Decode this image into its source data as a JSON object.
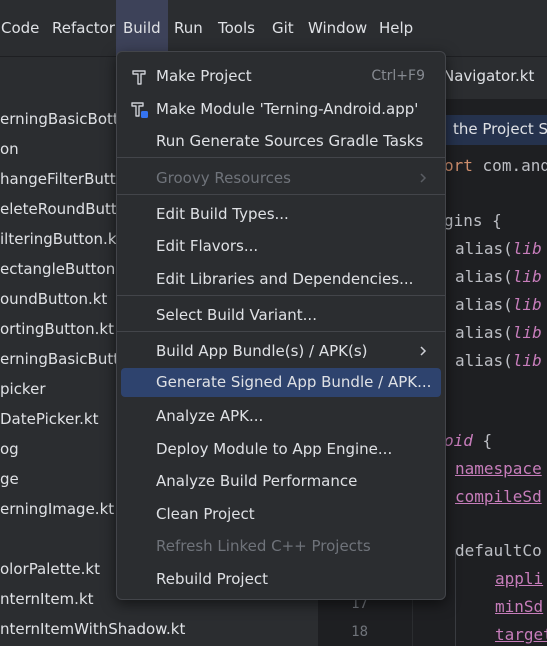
{
  "menubar": {
    "items": [
      {
        "label": "Code"
      },
      {
        "label": "Refactor"
      },
      {
        "label": "Build"
      },
      {
        "label": "Run"
      },
      {
        "label": "Tools"
      },
      {
        "label": "Git"
      },
      {
        "label": "Window"
      },
      {
        "label": "Help"
      }
    ],
    "active": "Build"
  },
  "build_menu": {
    "items": [
      {
        "label": "Make Project",
        "shortcut": "Ctrl+F9",
        "icon": "hammer-icon"
      },
      {
        "label": "Make Module 'Terning-Android.app'",
        "icon": "hammer-module-icon"
      },
      {
        "label": "Run Generate Sources Gradle Tasks"
      },
      {
        "label": "Groovy Resources",
        "disabled": true,
        "submenu": true
      },
      {
        "label": "Edit Build Types..."
      },
      {
        "label": "Edit Flavors..."
      },
      {
        "label": "Edit Libraries and Dependencies..."
      },
      {
        "label": "Select Build Variant..."
      },
      {
        "label": "Build App Bundle(s) / APK(s)",
        "submenu": true
      },
      {
        "label": "Generate Signed App Bundle / APK...",
        "selected": true
      },
      {
        "label": "Analyze APK..."
      },
      {
        "label": "Deploy Module to App Engine..."
      },
      {
        "label": "Analyze Build Performance"
      },
      {
        "label": "Clean Project"
      },
      {
        "label": "Refresh Linked C++ Projects",
        "disabled": true
      },
      {
        "label": "Rebuild Project"
      }
    ]
  },
  "project_tree": {
    "items": [
      "erningBasicBotto",
      "on",
      "hangeFilterButto",
      "eleteRoundButto",
      "ilteringButton.kt",
      "ectangleButton.kt",
      "oundButton.kt",
      "ortingButton.kt",
      "erningBasicButto",
      "picker",
      "DatePicker.kt",
      "og",
      "ge",
      "erningImage.kt",
      "olorPalette.kt",
      "nternItem.kt",
      "nternItemWithShadow.kt"
    ]
  },
  "editor": {
    "tab_label": "Navigator.kt",
    "banner_text": "the Project Str",
    "line_numbers": [
      "17",
      "18"
    ],
    "code": {
      "import_kw": "ort",
      "import_rest": "com.and",
      "plugins": "gins {",
      "alias": "alias(",
      "libs": "lib",
      "android_kw": "oid",
      "brace": "{",
      "namespace": "namespace",
      "compileSdk": "compileSd",
      "defaultConfig": "defaultCo",
      "applicationId": "appli",
      "minSdk": "minSd",
      "targetSdk": "target"
    }
  },
  "colors": {
    "selected_item": "#2e436e",
    "active_menu": "#3d4259",
    "menu_bg": "#2b2d30"
  }
}
